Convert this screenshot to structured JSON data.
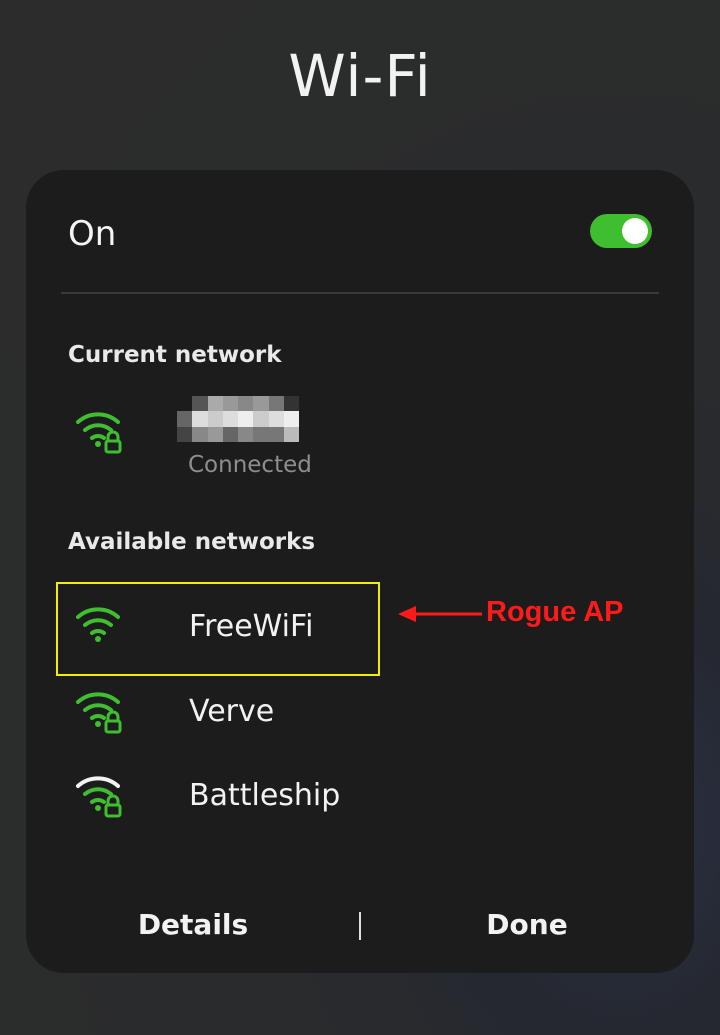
{
  "header": {
    "title": "Wi-Fi"
  },
  "wifi": {
    "state_label": "On",
    "enabled": true,
    "accent_color": "#3fbe2f"
  },
  "current_network": {
    "section_title": "Current network",
    "status": "Connected",
    "icon": "wifi-lock-icon"
  },
  "available_networks": {
    "section_title": "Available networks",
    "items": [
      {
        "name": "FreeWiFi",
        "icon": "wifi-icon",
        "secured": false
      },
      {
        "name": "Verve",
        "icon": "wifi-lock-icon",
        "secured": true
      },
      {
        "name": "Battleship",
        "icon": "wifi-lock-icon",
        "secured": true
      }
    ]
  },
  "footer": {
    "details_label": "Details",
    "done_label": "Done"
  },
  "annotation": {
    "label": "Rogue AP",
    "color": "#ff1a1a",
    "highlight_color": "#f2f000"
  }
}
